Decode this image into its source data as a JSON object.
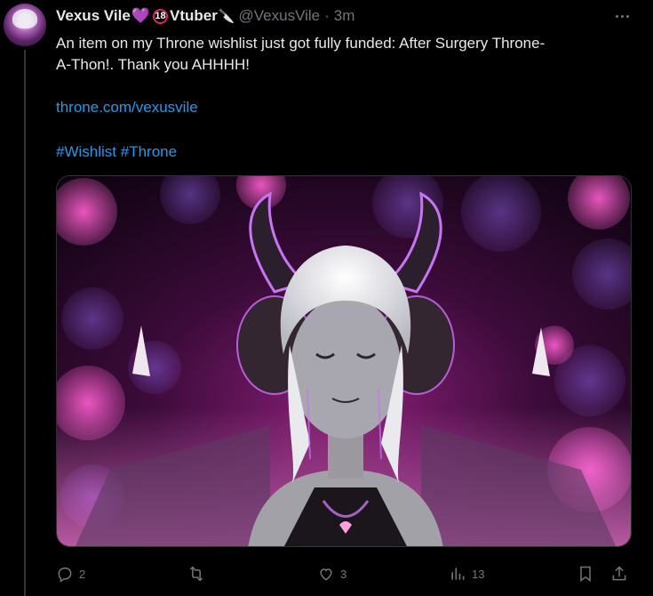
{
  "author": {
    "display_name": "Vexus Vile",
    "heart_emoji": "💜",
    "age_badge": "18",
    "tag_word": "Vtuber",
    "knife_emoji": "🔪",
    "handle": "@VexusVile",
    "separator": "·",
    "time": "3m"
  },
  "tweet": {
    "text_line1": "An item on my Throne wishlist just got fully funded: After Surgery Throne-",
    "text_line2": "A-Thon!. Thank you AHHHH!",
    "link": "throne.com/vexusvile",
    "hashtag1": "#Wishlist",
    "hashtag2": "#Throne"
  },
  "media": {
    "description": "illustrated character artwork"
  },
  "actions": {
    "reply_count": "2",
    "retweet_count": "",
    "like_count": "3",
    "view_count": "13"
  },
  "colors": {
    "accent": "#1d9bf0",
    "muted": "#71767b",
    "text": "#e7e9ea",
    "background": "#000000"
  },
  "icons": [
    "reply-icon",
    "retweet-icon",
    "like-icon",
    "views-icon",
    "bookmark-icon",
    "share-icon",
    "more-icon"
  ]
}
